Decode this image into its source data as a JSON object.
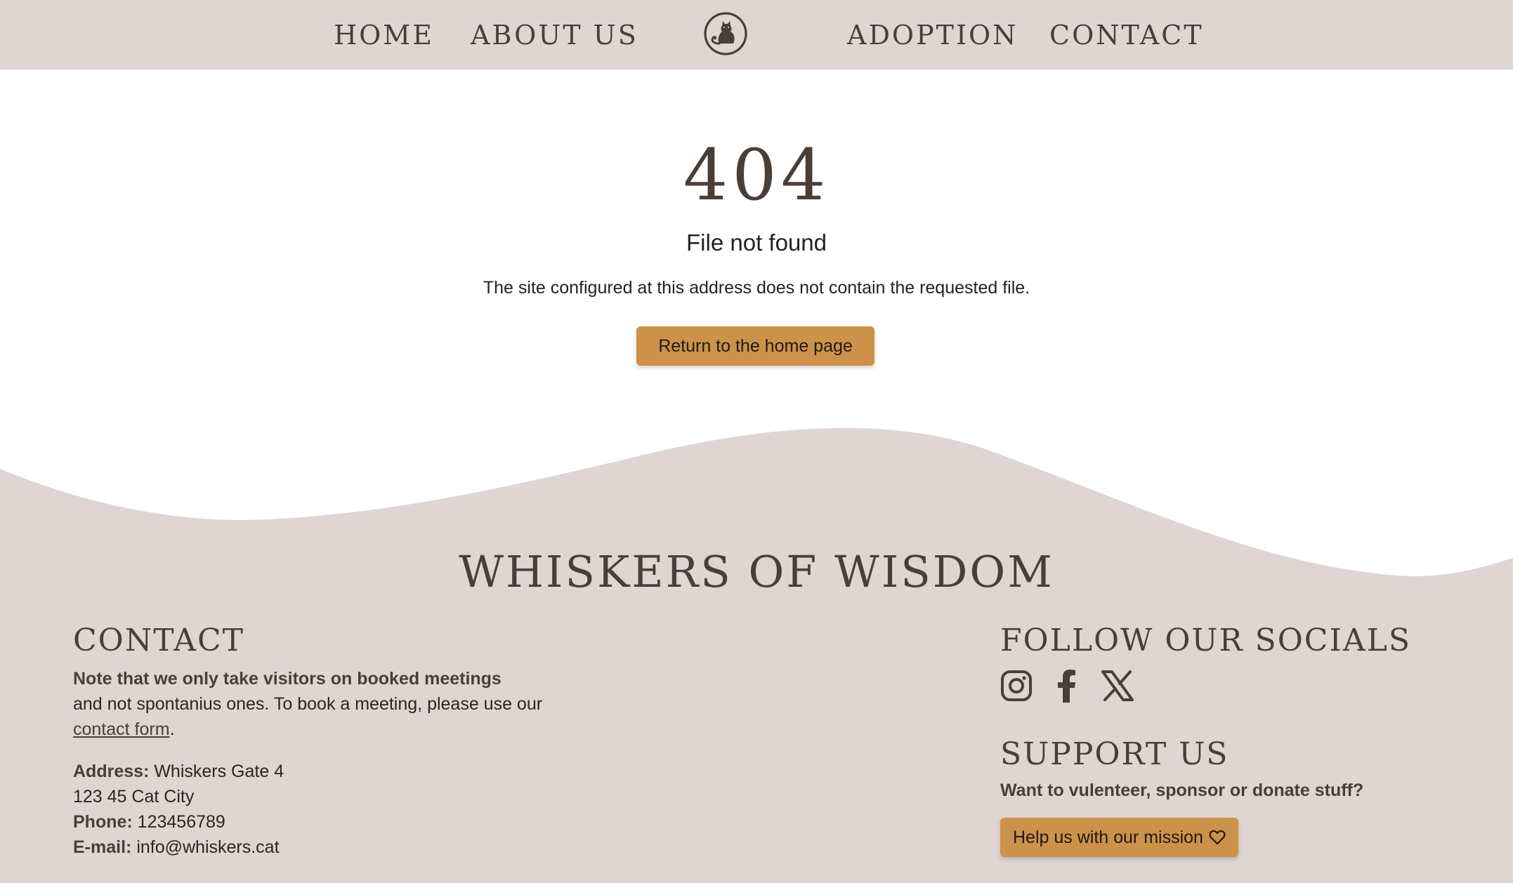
{
  "nav": {
    "home": "HOME",
    "about": "ABOUT US",
    "adoption": "ADOPTION",
    "contact": "CONTACT",
    "logo_icon": "cat-logo-icon"
  },
  "error": {
    "code": "404",
    "title": "File not found",
    "text": "The site configured at this address does not contain the requested file.",
    "button": "Return to the home page"
  },
  "footer": {
    "brand": "WHISKERS OF WISDOM",
    "contact": {
      "heading": "CONTACT",
      "note_bold": "Note that we only take visitors on booked meetings",
      "note_rest": "and not spontanius ones. To book a meeting, please use our",
      "link": "contact form",
      "period": ".",
      "address_label": "Address:",
      "address_line1": "Whiskers Gate 4",
      "address_line2": "123 45 Cat City",
      "phone_label": "Phone:",
      "phone": "123456789",
      "email_label": "E-mail:",
      "email": "info@whiskers.cat"
    },
    "socials": {
      "heading": "FOLLOW OUR SOCIALS",
      "icons": [
        "instagram-icon",
        "facebook-icon",
        "x-icon"
      ]
    },
    "support": {
      "heading": "SUPPORT US",
      "question": "Want to vulenteer, sponsor or donate stuff?",
      "button": "Help us with our mission",
      "button_icon": "heart-icon"
    }
  },
  "colors": {
    "nav_bg": "#dfd5d3",
    "footer_bg": "#dfd5d3",
    "text_dark": "#4a3f37",
    "button": "#cd9249"
  }
}
